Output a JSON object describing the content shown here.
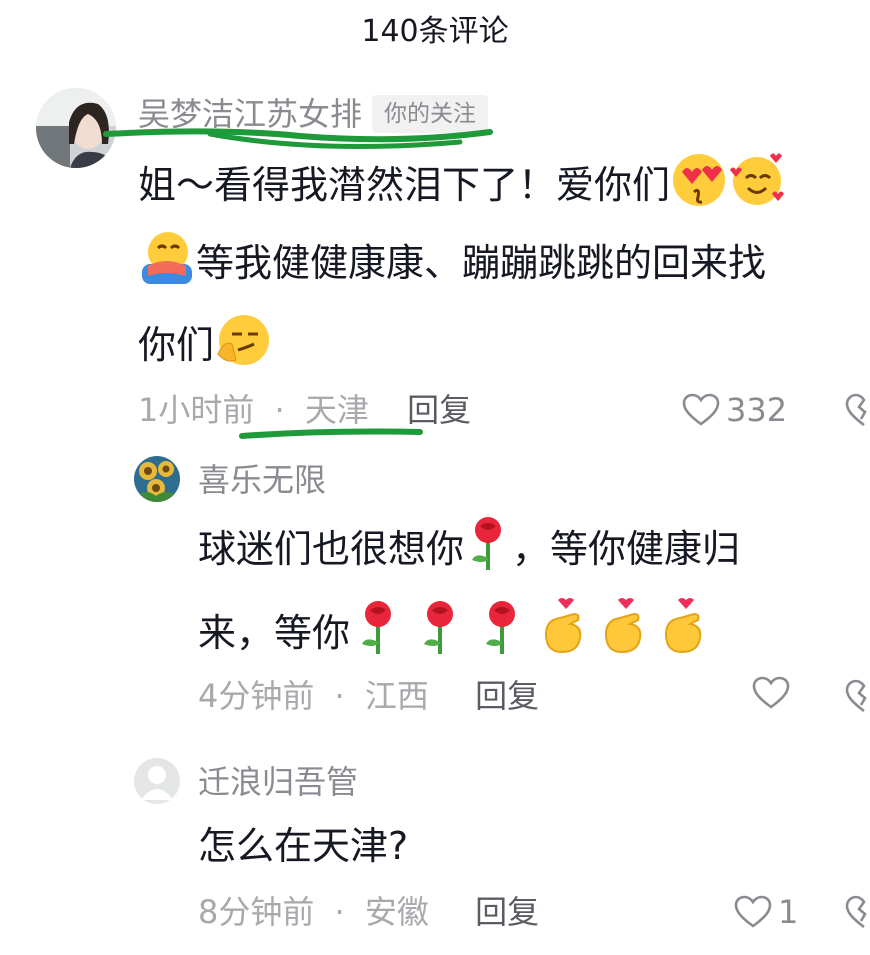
{
  "header": {
    "title": "140条评论"
  },
  "comments": [
    {
      "user": "吴梦洁江苏女排",
      "badge": "你的关注",
      "lines": [
        "姐～看得我潸然泪下了！爱你们",
        "等我健健康康、蹦蹦跳跳的回来找",
        "你们"
      ],
      "time": "1小时前",
      "location": "天津",
      "reply_label": "回复",
      "likes": "332"
    },
    {
      "user": "喜乐无限",
      "lines": [
        "球迷们也很想你",
        "，等你健康归",
        "来，等你"
      ],
      "time": "4分钟前",
      "location": "江西",
      "reply_label": "回复"
    },
    {
      "user": "迁浪归吾管",
      "lines": [
        "怎么在天津?"
      ],
      "time": "8分钟前",
      "location": "安徽",
      "reply_label": "回复",
      "likes": "1"
    }
  ],
  "meta_separator": "·",
  "icons": [
    "heart-icon",
    "dislike-icon",
    "heart-eyes-emoji",
    "smiling-hearts-emoji",
    "hug-emoji",
    "thinking-smirk-emoji",
    "rose-emoji",
    "finger-heart-emoji"
  ],
  "colors": {
    "annotation_green": "#1f9a3a",
    "name_gray": "#8a8b91",
    "text": "#161823"
  }
}
